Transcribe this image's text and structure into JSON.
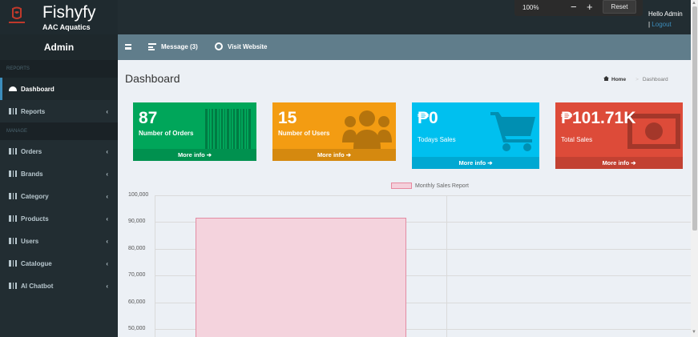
{
  "brand": {
    "title": "Fishyfy",
    "subtitle": "AAC Aquatics"
  },
  "zoom": {
    "level": "100%",
    "minus": "−",
    "plus": "+",
    "reset": "Reset"
  },
  "user": {
    "greeting": "Hello Admin",
    "logout_sep": "|",
    "logout": " Logout"
  },
  "sidebar": {
    "title": "Admin",
    "section_reports": "REPORTS",
    "section_manage": "MANAGE",
    "items": [
      {
        "label": "Dashboard"
      },
      {
        "label": "Reports"
      },
      {
        "label": "Orders"
      },
      {
        "label": "Brands"
      },
      {
        "label": "Category"
      },
      {
        "label": "Products"
      },
      {
        "label": "Users"
      },
      {
        "label": "Catalogue"
      },
      {
        "label": "AI Chatbot"
      }
    ],
    "chevron": "‹"
  },
  "topnav": {
    "message": "Message (3)",
    "visit": "Visit Website"
  },
  "page": {
    "title": "Dashboard"
  },
  "breadcrumb": {
    "home": "Home",
    "sep": ">",
    "current": "Dashboard"
  },
  "stats": [
    {
      "value": "87",
      "label": "Number of Orders",
      "footer": "More info ➔",
      "color": "#00a65a",
      "icon": "barcode-icon"
    },
    {
      "value": "15",
      "label": "Number of Users",
      "footer": "More info ➔",
      "color": "#f39c12",
      "icon": "users-icon"
    },
    {
      "value": "₱0",
      "label": "Todays Sales",
      "footer": "More info ➔",
      "color": "#00c0ef",
      "icon": "cart-icon"
    },
    {
      "value": "₱101.71K",
      "label": "Total Sales",
      "footer": "More info ➔",
      "color": "#dd4b39",
      "icon": "money-icon"
    }
  ],
  "chart_data": {
    "type": "bar",
    "series": [
      {
        "name": "Monthly Sales Report",
        "values": [
          91500
        ]
      }
    ],
    "y_ticks": [
      "100,000",
      "90,000",
      "80,000",
      "70,000",
      "60,000",
      "50,000"
    ],
    "ylim": [
      47000,
      100000
    ],
    "grid": true,
    "legend": "top-center",
    "bar_color": "#f4d3dd",
    "bar_border": "#e38ca3"
  }
}
